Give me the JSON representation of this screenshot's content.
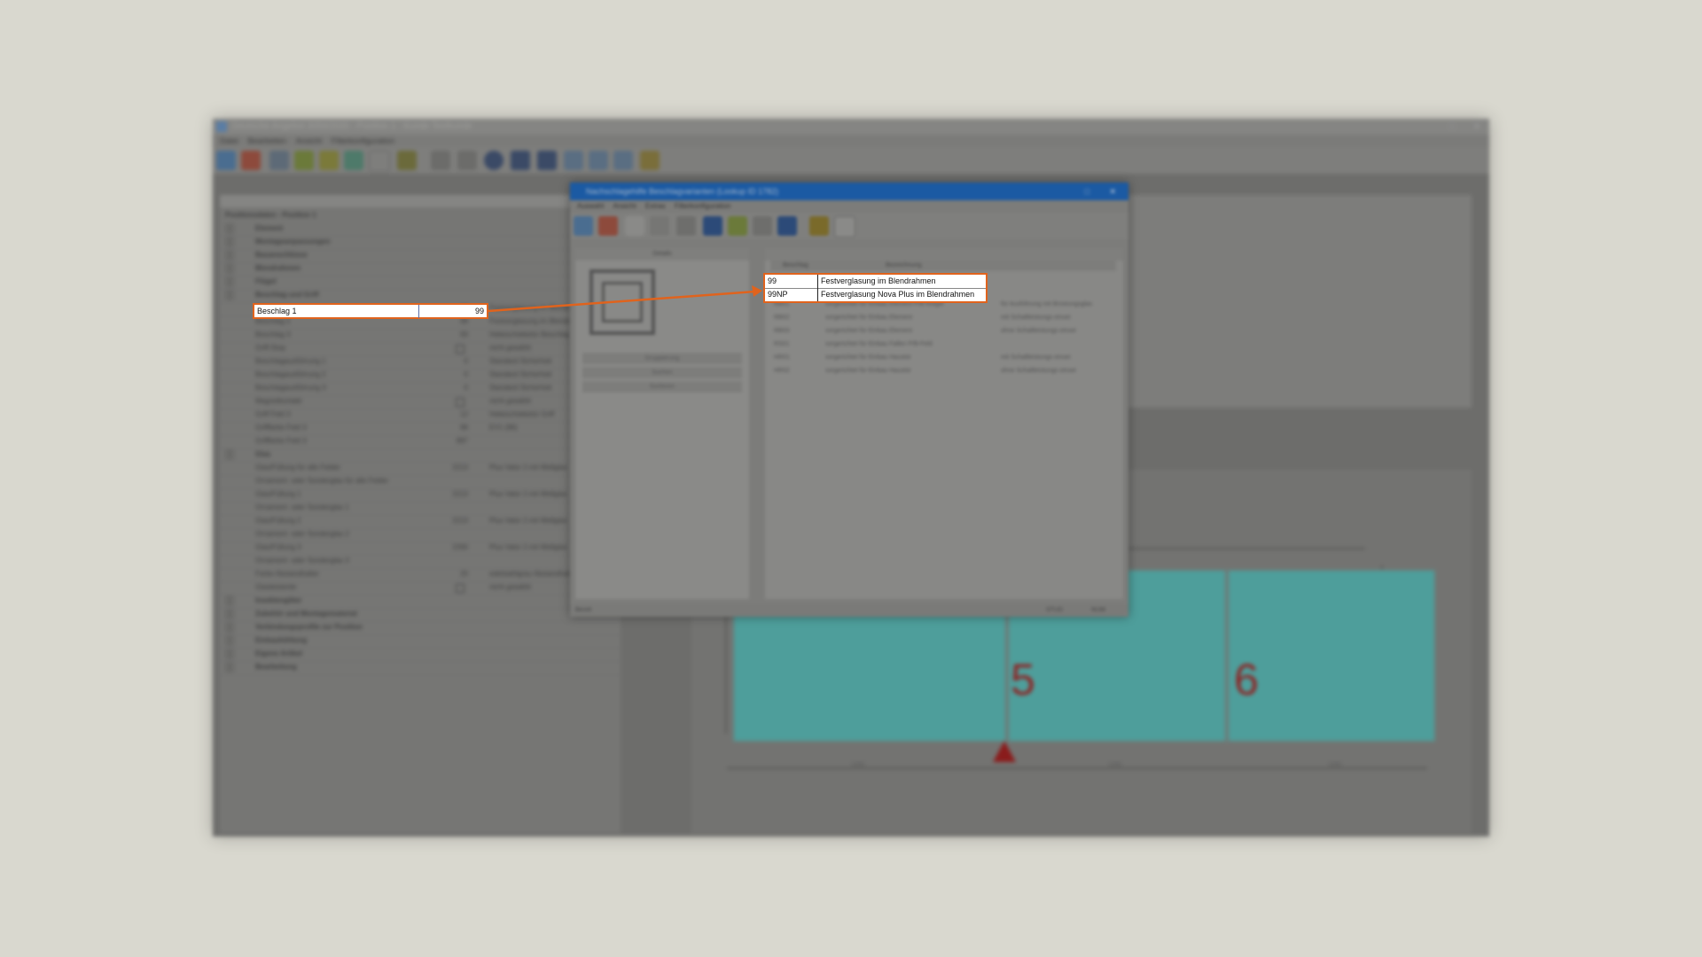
{
  "app": {
    "title": "Deutsche Angebot 3050/2020 - Position 1 - Kunde Testkunde",
    "menu": [
      "Datei",
      "Bearbeiten",
      "Ansicht",
      "Filterkonfiguration"
    ]
  },
  "grid": {
    "header": "Positionsdaten - Position 1",
    "rows": [
      {
        "label": "Element",
        "bold": true
      },
      {
        "label": "Montageanpassungen",
        "bold": true
      },
      {
        "label": "Bauanschlüsse",
        "bold": true
      },
      {
        "label": "Blendrahmen",
        "bold": true
      },
      {
        "label": "Flügel",
        "bold": true
      },
      {
        "label": "Beschlag und Griff",
        "bold": true
      },
      {
        "label": "Beschlag 1",
        "value": "99",
        "desc": "Festverglasung im Blendrahmen",
        "highlight": true
      },
      {
        "label": "Beschlag 2",
        "value": "99",
        "desc": "Festverglasung im Blendrahmen"
      },
      {
        "label": "Beschlag 3",
        "value": "93",
        "desc": "Hebeschiebetür Beschlag"
      },
      {
        "label": "Griff-Stop",
        "check": true,
        "desc": "nicht gewählt"
      },
      {
        "label": "Beschlagausführung 1",
        "value": "0",
        "desc": "Standard Sicherheit"
      },
      {
        "label": "Beschlagausführung 2",
        "value": "0",
        "desc": "Standard Sicherheit"
      },
      {
        "label": "Beschlagausführung 3",
        "value": "0",
        "desc": "Standard Sicherheit"
      },
      {
        "label": "Magnetkontakt",
        "check": true,
        "desc": "nicht gewählt"
      },
      {
        "label": "Griff Feld 3",
        "value": "12",
        "desc": "Hebeschiebetür Griff"
      },
      {
        "label": "Grifffarbe Feld 3",
        "value": "96",
        "desc": "EV1 (96)"
      },
      {
        "label": "Grifffarbe Feld 3",
        "value": "997",
        "desc": ""
      },
      {
        "label": "Glas",
        "bold": true
      },
      {
        "label": "Glas/Füllung für alle Felder",
        "value": "2213",
        "desc": "Plus Valor 2 mit Wellglas"
      },
      {
        "label": "Ornament- oder Sonderglas für alle Felder",
        "value": "",
        "desc": ""
      },
      {
        "label": "Glas/Füllung 1",
        "value": "2213",
        "desc": "Plus Valor 2 mit Wellglas"
      },
      {
        "label": "Ornament- oder Sonderglas 1",
        "value": "",
        "desc": ""
      },
      {
        "label": "Glas/Füllung 2",
        "value": "2213",
        "desc": "Plus Valor 2 mit Wellglas"
      },
      {
        "label": "Ornament- oder Sonderglas 2",
        "value": "",
        "desc": ""
      },
      {
        "label": "Glas/Füllung 3",
        "value": "2260",
        "desc": "Plus Valor 2 mit Wellglas"
      },
      {
        "label": "Ornament- oder Sonderglas 3",
        "value": "",
        "desc": ""
      },
      {
        "label": "Farbe Abstandhalter",
        "value": "20",
        "desc": "edelstahlgrau Abstandhalter"
      },
      {
        "label": "Glasleistenbr",
        "check": true,
        "desc": "nicht gewählt"
      },
      {
        "label": "Insektengitter",
        "bold": true
      },
      {
        "label": "Zubehör und Montagematerial",
        "bold": true
      },
      {
        "label": "Verbindungsprofile zur Position",
        "bold": true
      },
      {
        "label": "Einbauhöhlung",
        "bold": true
      },
      {
        "label": "Eigene Artikel",
        "bold": true
      },
      {
        "label": "Bearbeitung",
        "bold": true
      }
    ]
  },
  "dialog": {
    "title": "Nachschlagehilfe Beschlagvarianten (Lookup ID 1782)",
    "menu": [
      "Auswahl",
      "Ansicht",
      "Extras",
      "Filterkonfiguration"
    ],
    "details_label": "Details",
    "buttons": [
      "Gruppierung",
      "Suchen",
      "Sortieren"
    ],
    "columns": [
      "Beschlag",
      "Bezeichnung"
    ],
    "rows": [
      {
        "code": "99",
        "name": "Festverglasung im Blendrahmen",
        "highlight": true
      },
      {
        "code": "99NP",
        "name": "Festverglasung Nova Plus im Blendrahmen",
        "highlight": true
      },
      {
        "code": "RB01",
        "name": "vorgerichtet für Einbau Element P/B-Rolgitt",
        "extra": "für Ausführung mit Brüstungsglas"
      },
      {
        "code": "RB02",
        "name": "vorgerichtet für Einbau Element",
        "extra": "mit Schaltleistungs einsei"
      },
      {
        "code": "RB03",
        "name": "vorgerichtet für Einbau Element",
        "extra": "ohne Schaltleistungs einsei"
      },
      {
        "code": "RS01",
        "name": "vorgerichtet für Einbau Fallen P/B-Feld",
        "extra": ""
      },
      {
        "code": "HR01",
        "name": "vorgerichtet für Einbau Haustür",
        "extra": "mit Schaltleistungs einsei"
      },
      {
        "code": "HR02",
        "name": "vorgerichtet für Einbau Haustür",
        "extra": "ohne Schaltleistungs einsei"
      }
    ],
    "status_left": "Bereit",
    "status_right": [
      "STUD",
      "NUM"
    ]
  },
  "drawing": {
    "pane_labels": [
      "5",
      "6"
    ],
    "dims": [
      "1000",
      "1000",
      "1000"
    ]
  },
  "colors": {
    "highlight": "#e0631d",
    "title_blue": "#1b5aa3",
    "glass": "#4e9e9b",
    "pane_number": "#8e2222"
  }
}
